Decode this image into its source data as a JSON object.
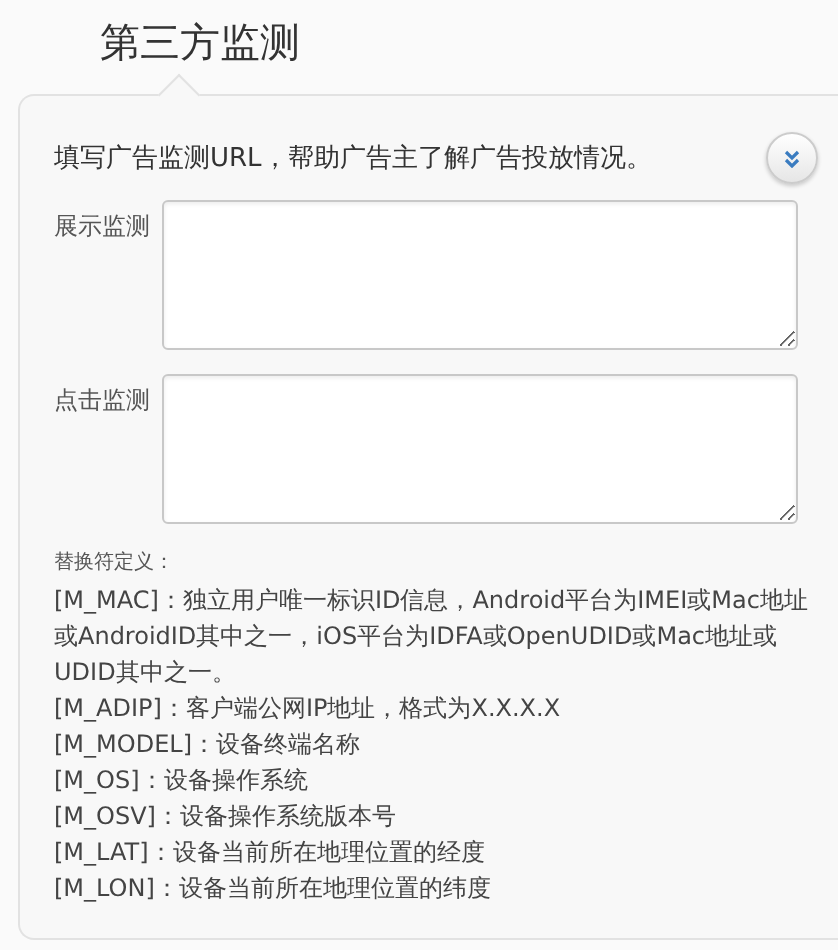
{
  "title": "第三方监测",
  "intro": "填写广告监测URL，帮助广告主了解广告投放情况。",
  "fields": [
    {
      "label": "展示监测"
    },
    {
      "label": "点击监测"
    }
  ],
  "definitions_title": "替换符定义：",
  "definitions": [
    "[M_MAC]：独立用户唯一标识ID信息，Android平台为IMEI或Mac地址或AndroidID其中之一，iOS平台为IDFA或OpenUDID或Mac地址或UDID其中之一。",
    "[M_ADIP]：客户端公网IP地址，格式为X.X.X.X",
    "[M_MODEL]：设备终端名称",
    "[M_OS]：设备操作系统",
    "[M_OSV]：设备操作系统版本号",
    "[M_LAT]：设备当前所在地理位置的经度",
    "[M_LON]：设备当前所在地理位置的纬度"
  ]
}
